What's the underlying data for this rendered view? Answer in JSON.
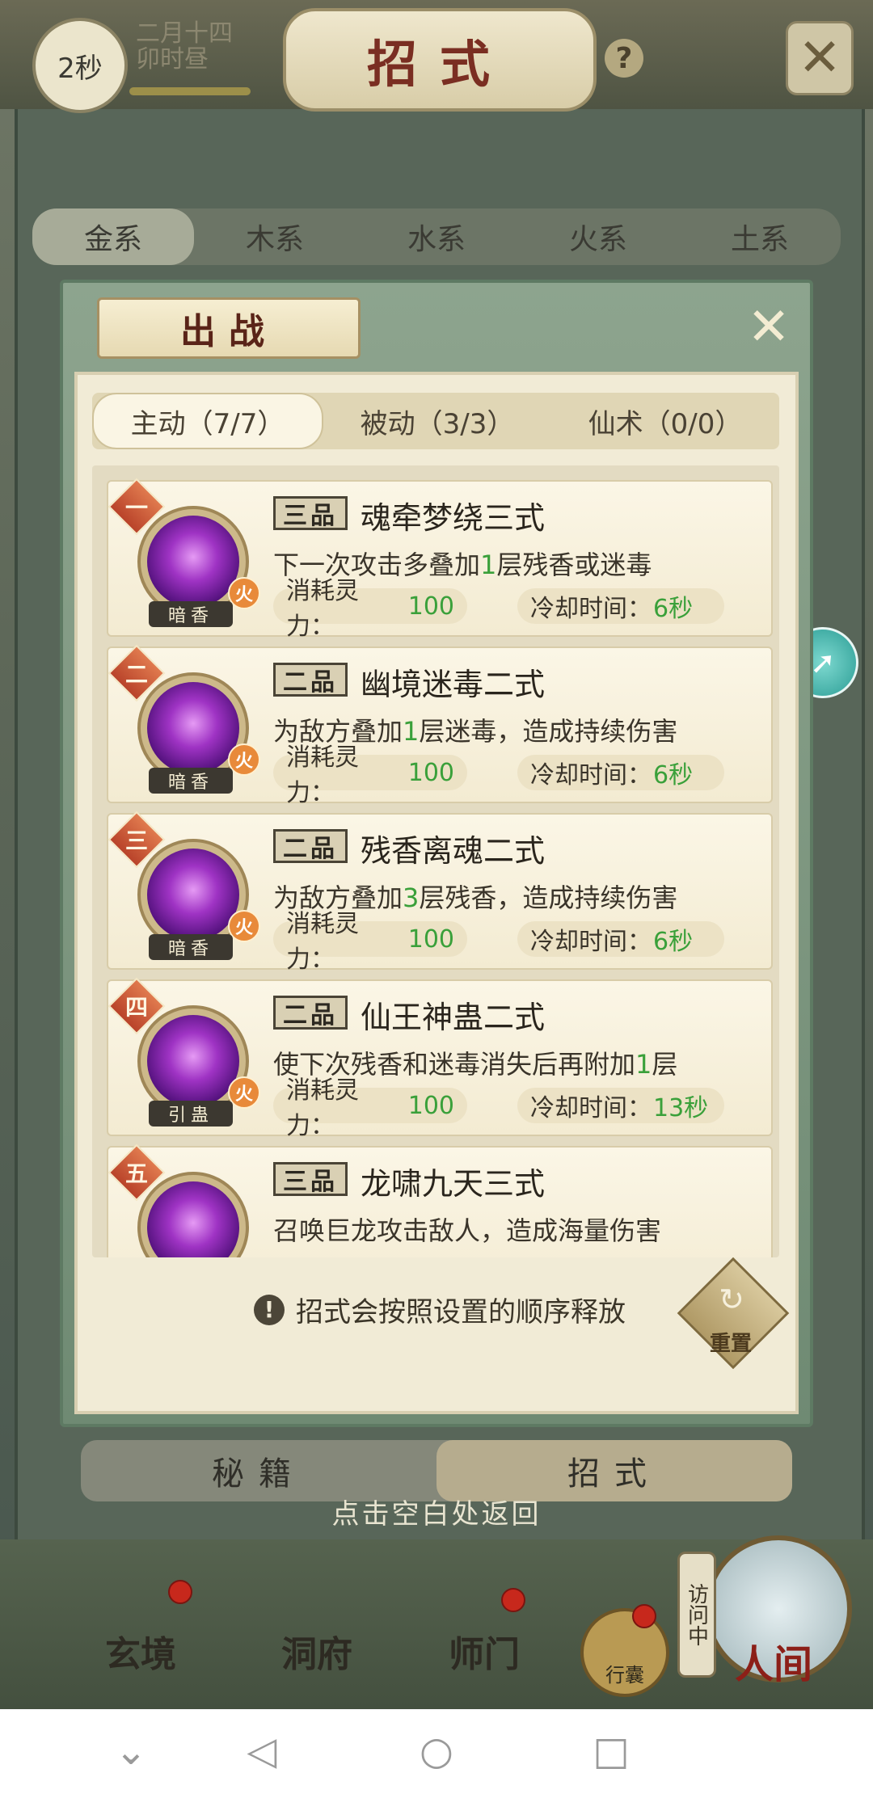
{
  "topbar": {
    "timer": "2秒",
    "date_line1": "二月十四",
    "date_line2": "卯时昼",
    "title": "招式",
    "help": "?"
  },
  "element_tabs": [
    "金系",
    "木系",
    "水系",
    "火系",
    "土系"
  ],
  "dialog": {
    "title": "出战",
    "tabs": [
      "主动（7/7）",
      "被动（3/3）",
      "仙术（0/0）"
    ],
    "skills": [
      {
        "rank": "一",
        "grade": "三品",
        "name": "魂牵梦绕三式",
        "desc_pre": "下一次攻击多叠加",
        "desc_num": "1",
        "desc_post": "层残香或迷毒",
        "element": "火",
        "icon_label": "暗香",
        "cost_label": "消耗灵力：",
        "cost": "100",
        "cd_label": "冷却时间：",
        "cd": "6秒"
      },
      {
        "rank": "二",
        "grade": "二品",
        "name": "幽境迷毒二式",
        "desc_pre": "为敌方叠加",
        "desc_num": "1",
        "desc_post": "层迷毒，造成持续伤害",
        "element": "火",
        "icon_label": "暗香",
        "cost_label": "消耗灵力：",
        "cost": "100",
        "cd_label": "冷却时间：",
        "cd": "6秒"
      },
      {
        "rank": "三",
        "grade": "二品",
        "name": "残香离魂二式",
        "desc_pre": "为敌方叠加",
        "desc_num": "3",
        "desc_post": "层残香，造成持续伤害",
        "element": "火",
        "icon_label": "暗香",
        "cost_label": "消耗灵力：",
        "cost": "100",
        "cd_label": "冷却时间：",
        "cd": "6秒"
      },
      {
        "rank": "四",
        "grade": "二品",
        "name": "仙王神蛊二式",
        "desc_pre": "使下次残香和迷毒消失后再附加",
        "desc_num": "1",
        "desc_post": "层",
        "element": "火",
        "icon_label": "引蛊",
        "cost_label": "消耗灵力：",
        "cost": "100",
        "cd_label": "冷却时间：",
        "cd": "13秒"
      },
      {
        "rank": "五",
        "grade": "三品",
        "name": "龙啸九天三式",
        "desc_pre": "召唤巨龙攻击敌人，造成海量伤害",
        "desc_num": "",
        "desc_post": "",
        "element": "",
        "icon_label": "",
        "cost_label": "",
        "cost": "",
        "cd_label": "",
        "cd": ""
      }
    ],
    "hint": "招式会按照设置的顺序释放",
    "reset": "重置"
  },
  "bottom_tabs": [
    "秘籍",
    "招式"
  ],
  "return_hint": "点击空白处返回",
  "nav": {
    "items": [
      "玄境",
      "洞府",
      "师门"
    ],
    "bag": "行囊",
    "visiting": "访问中",
    "world": "人间"
  },
  "colors": {
    "accent_green": "#3aa03a",
    "title_red": "#7a2e22",
    "rank_orange": "#c9532f"
  }
}
